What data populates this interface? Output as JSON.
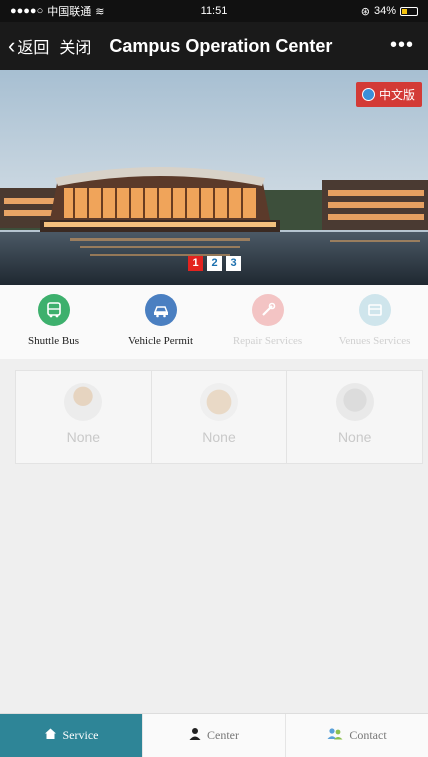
{
  "status_bar": {
    "carrier": "中国联通",
    "time": "11:51",
    "battery": "34%",
    "battery_level": 0.34
  },
  "nav": {
    "back_label": "返回",
    "close_label": "关闭",
    "title": "Campus Operation Center",
    "more_label": "•••"
  },
  "banner": {
    "lang_button": "中文版",
    "pages": [
      "1",
      "2",
      "3"
    ],
    "active_page": "1"
  },
  "services": [
    {
      "label": "Shuttle Bus",
      "icon": "bus-icon",
      "color": "#3db06d",
      "enabled": true
    },
    {
      "label": "Vehicle Permit",
      "icon": "car-icon",
      "color": "#4a7fc1",
      "enabled": true
    },
    {
      "label": "Repair Services",
      "icon": "wrench-icon",
      "color": "#f3c4c4",
      "enabled": false
    },
    {
      "label": "Venues Services",
      "icon": "venue-icon",
      "color": "#cfe5ec",
      "enabled": false
    }
  ],
  "grid": [
    {
      "label": "None",
      "icon": "person-icon"
    },
    {
      "label": "None",
      "icon": "food-icon"
    },
    {
      "label": "None",
      "icon": "building-icon"
    }
  ],
  "tabs": [
    {
      "label": "Service",
      "icon": "home-icon",
      "active": true
    },
    {
      "label": "Center",
      "icon": "person-icon",
      "active": false
    },
    {
      "label": "Contact",
      "icon": "contacts-icon",
      "active": false
    }
  ],
  "colors": {
    "nav_bg": "#1a1a1a",
    "accent_tab": "#2e8597",
    "lang_button": "#d33a36",
    "active_dot": "#e3231f"
  }
}
